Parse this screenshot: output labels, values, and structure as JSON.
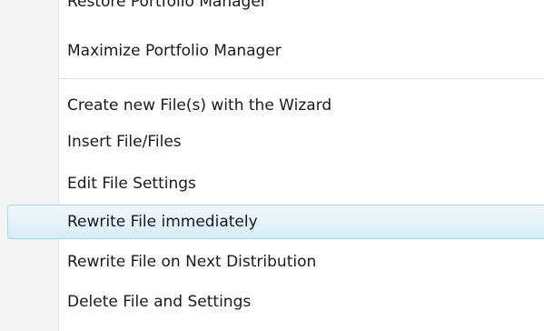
{
  "menu": {
    "items": [
      {
        "label": "Restore Portfolio Manager"
      },
      {
        "label": "Maximize Portfolio Manager"
      },
      {
        "label": "Create new File(s) with the Wizard"
      },
      {
        "label": "Insert File/Files"
      },
      {
        "label": "Edit File Settings"
      },
      {
        "label": "Rewrite File immediately"
      },
      {
        "label": "Rewrite File on Next Distribution"
      },
      {
        "label": "Delete File and Settings"
      }
    ],
    "highlighted_index": 5
  },
  "colors": {
    "highlight_border": "#a8d8eb",
    "highlight_fill": "#e6f3fa",
    "gutter": "#f4f4f4",
    "text": "#1a1a1a"
  }
}
